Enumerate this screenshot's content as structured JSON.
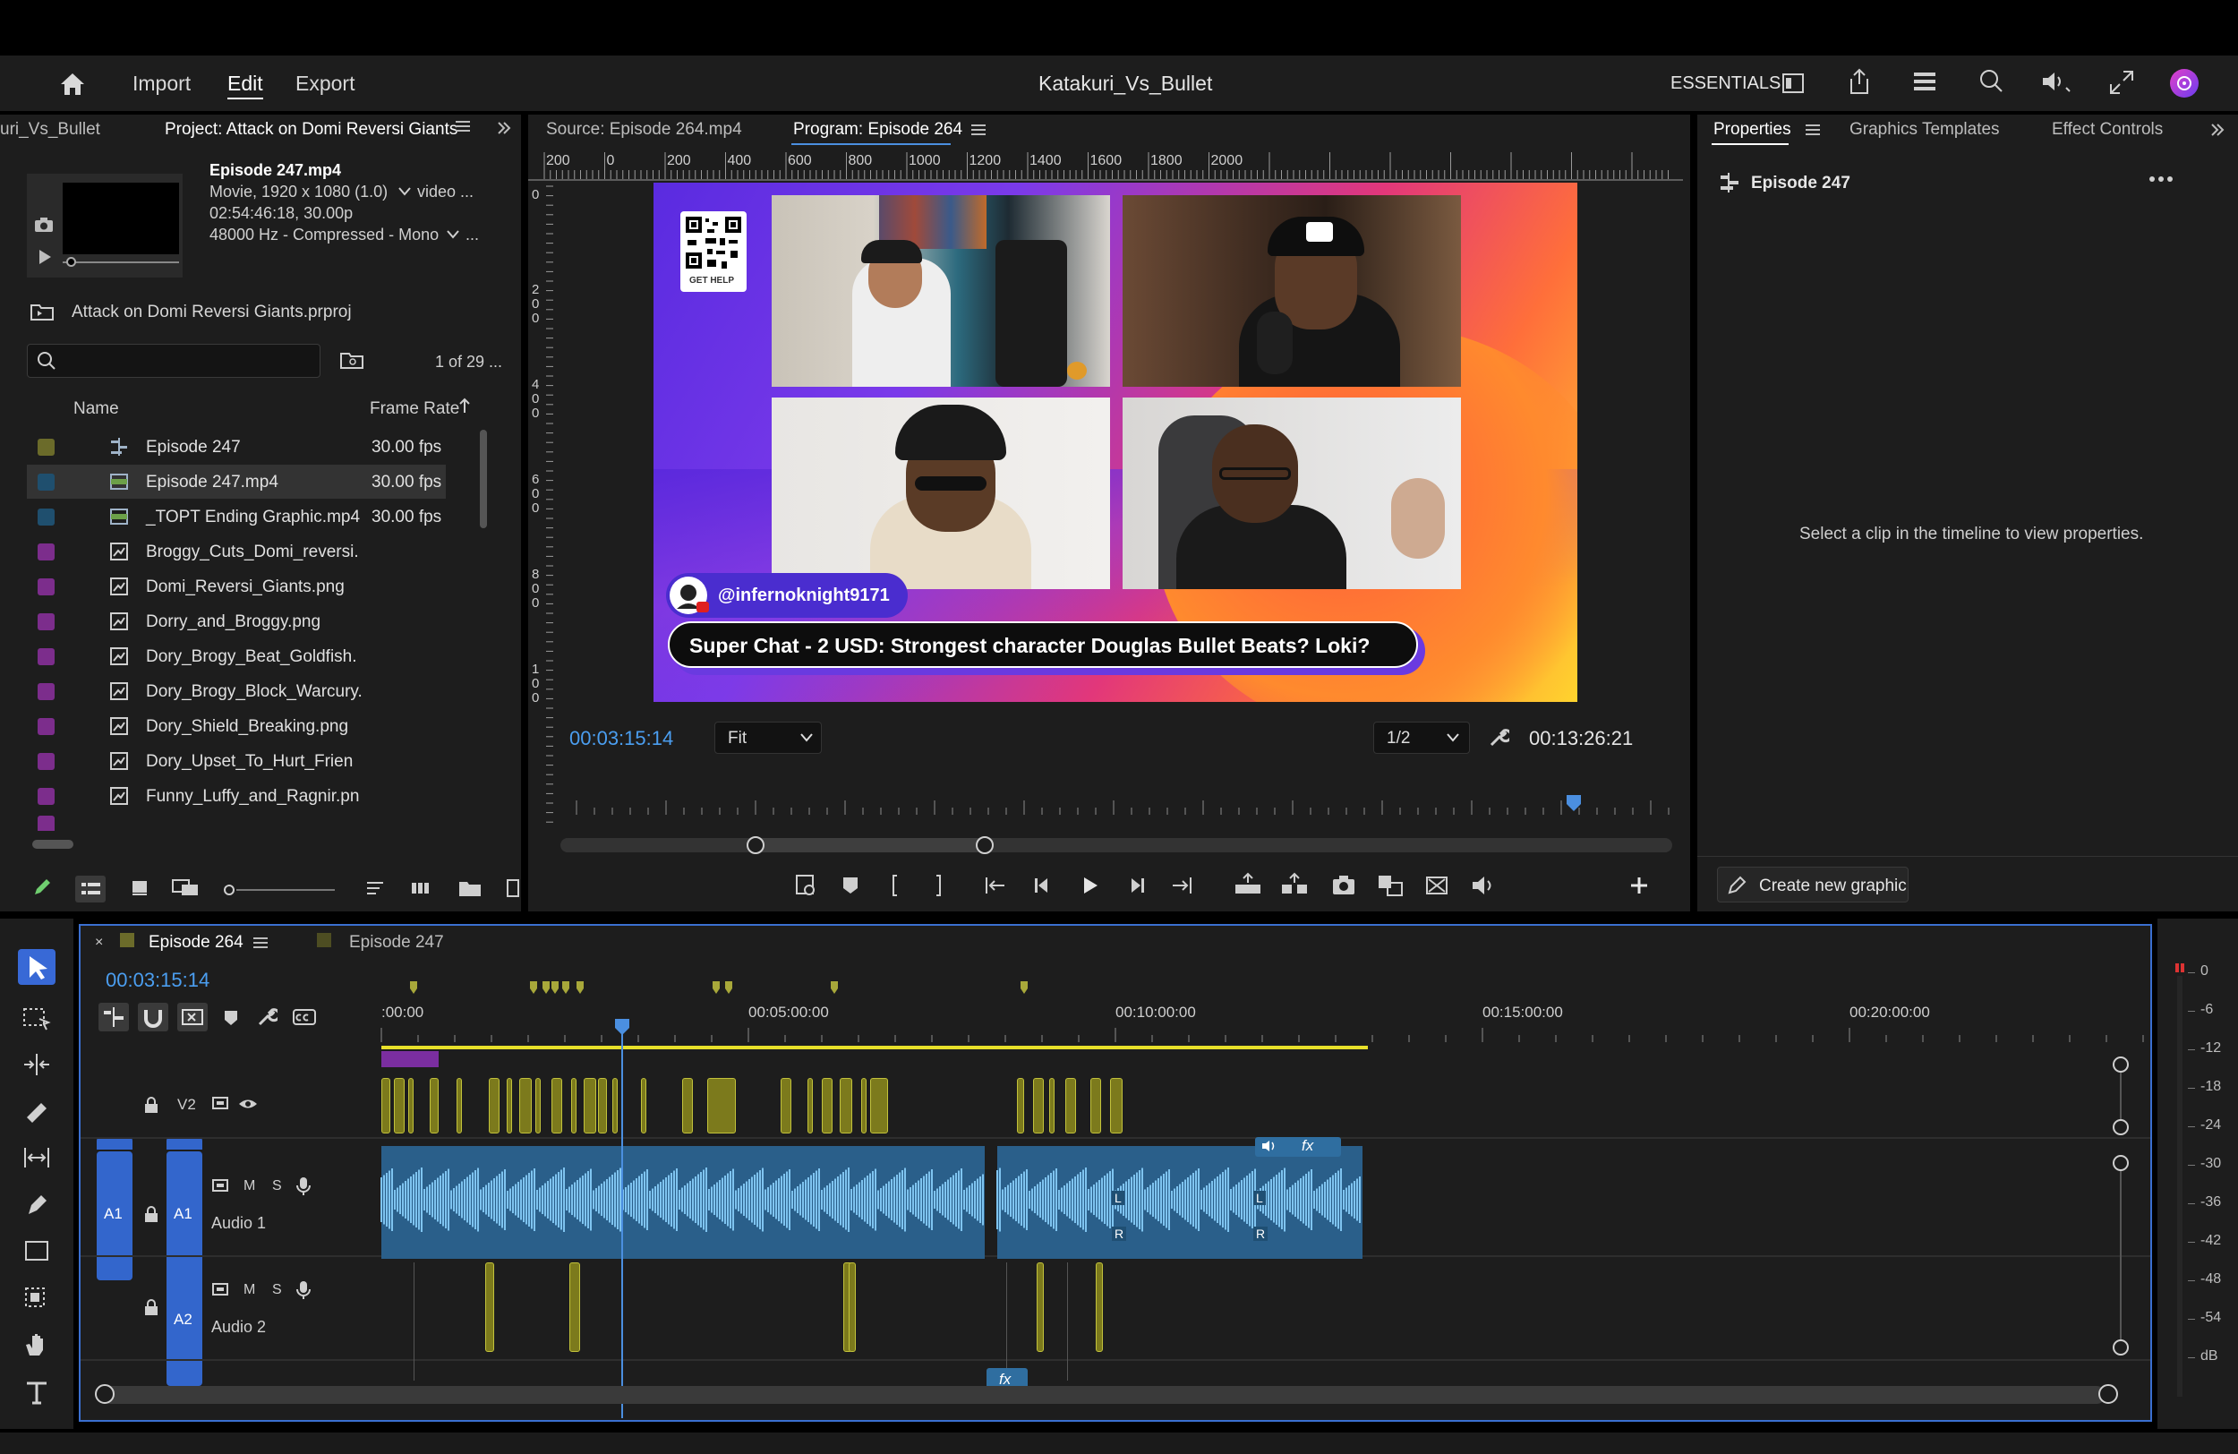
{
  "header": {
    "nav": {
      "import": "Import",
      "edit": "Edit",
      "export": "Export"
    },
    "title": "Katakuri_Vs_Bullet",
    "workspace": "ESSENTIALS",
    "icons": [
      "home-icon",
      "panel-layout-icon",
      "share-icon",
      "menu-list-icon",
      "search-icon",
      "volume-icon",
      "fullscreen-icon",
      "profile-avatar"
    ]
  },
  "project_panel": {
    "tab_left": "uri_Vs_Bullet",
    "tab_active": "Project: Attack on Domi Reversi Giants",
    "clip_info": {
      "name": "Episode 247.mp4",
      "line1": "Movie, 1920 x 1080 (1.0)",
      "line1_extra": "video ...",
      "line2": "02:54:46:18, 30.00p",
      "line3": "48000 Hz - Compressed - Mono",
      "line3_extra": "..."
    },
    "project_file": "Attack on Domi Reversi Giants.prproj",
    "search_placeholder": "",
    "item_count": "1 of 29 ...",
    "columns": {
      "name": "Name",
      "frame_rate": "Frame Rate"
    },
    "items": [
      {
        "name": "Episode 247",
        "fps": "30.00 fps",
        "color": "#6b6b2a",
        "type": "sequence"
      },
      {
        "name": "Episode 247.mp4",
        "fps": "30.00 fps",
        "color": "#1f4f6e",
        "type": "video",
        "selected": true
      },
      {
        "name": "_TOPT Ending Graphic.mp4",
        "fps": "30.00 fps",
        "color": "#1f4f6e",
        "type": "video"
      },
      {
        "name": "Broggy_Cuts_Domi_reversi.",
        "fps": "",
        "color": "#7c2d8c",
        "type": "image"
      },
      {
        "name": "Domi_Reversi_Giants.png",
        "fps": "",
        "color": "#7c2d8c",
        "type": "image"
      },
      {
        "name": "Dorry_and_Broggy.png",
        "fps": "",
        "color": "#7c2d8c",
        "type": "image"
      },
      {
        "name": "Dory_Brogy_Beat_Goldfish.",
        "fps": "",
        "color": "#7c2d8c",
        "type": "image"
      },
      {
        "name": "Dory_Brogy_Block_Warcury.",
        "fps": "",
        "color": "#7c2d8c",
        "type": "image"
      },
      {
        "name": "Dory_Shield_Breaking.png",
        "fps": "",
        "color": "#7c2d8c",
        "type": "image"
      },
      {
        "name": "Dory_Upset_To_Hurt_Frien",
        "fps": "",
        "color": "#7c2d8c",
        "type": "image"
      },
      {
        "name": "Funny_Luffy_and_Ragnir.pn",
        "fps": "",
        "color": "#7c2d8c",
        "type": "image"
      }
    ]
  },
  "monitor": {
    "source_tab": "Source: Episode 264.mp4",
    "program_tab": "Program: Episode 264",
    "ruler_top": [
      "200",
      "0",
      "200",
      "400",
      "600",
      "800",
      "1000",
      "1200",
      "1400",
      "1600",
      "1800",
      "2000"
    ],
    "ruler_left": [
      "0",
      "200",
      "400",
      "600",
      "800",
      "100"
    ],
    "video": {
      "qr_label": "GET HELP",
      "handle": "@infernoknight9171",
      "superchat": "Super Chat - 2 USD: Strongest character Douglas Bullet Beats? Loki?"
    },
    "timecode_current": "00:03:15:14",
    "zoom": "Fit",
    "resolution": "1/2",
    "timecode_duration": "00:13:26:21"
  },
  "properties": {
    "tabs": [
      "Properties",
      "Graphics Templates",
      "Effect Controls"
    ],
    "sequence_name": "Episode 247",
    "empty_message": "Select a clip in the timeline to view properties.",
    "create_button": "Create new graphic"
  },
  "timeline": {
    "tabs": [
      "Episode 264",
      "Episode 247"
    ],
    "timecode": "00:03:15:14",
    "ruler": [
      ":00:00",
      "00:05:00:00",
      "00:10:00:00",
      "00:15:00:00",
      "00:20:00:00"
    ],
    "tracks": {
      "v2": "V2",
      "a1_src": "A1",
      "a1": "A1",
      "a1_name": "Audio 1",
      "a2": "A2",
      "a2_name": "Audio 2",
      "mute": "M",
      "solo": "S"
    },
    "fx_label": "fx",
    "channel_l": "L",
    "channel_r": "R"
  },
  "audio_meter": {
    "labels": [
      "0",
      "-6",
      "-12",
      "-18",
      "-24",
      "-30",
      "-36",
      "-42",
      "-48",
      "-54",
      "dB"
    ]
  }
}
